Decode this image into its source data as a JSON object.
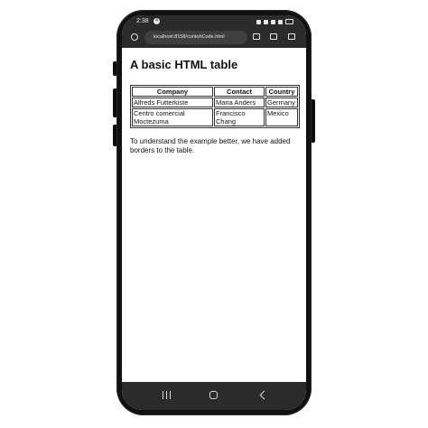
{
  "status_bar": {
    "time": "2:38",
    "notification_badge": "4"
  },
  "browser": {
    "url": "localhost:8158/contohCode.html"
  },
  "page": {
    "heading": "A basic HTML table",
    "table": {
      "headers": [
        "Company",
        "Contact",
        "Country"
      ],
      "rows": [
        [
          "Alfreds Futterkiste",
          "Maria Anders",
          "Germany"
        ],
        [
          "Centro comercial Moctezuma",
          "Francisco Chang",
          "Mexico"
        ]
      ]
    },
    "note": "To understand the example better, we have added borders to the table."
  },
  "nav_bar": {
    "icons": [
      "recents-icon",
      "home-icon",
      "back-icon"
    ]
  }
}
